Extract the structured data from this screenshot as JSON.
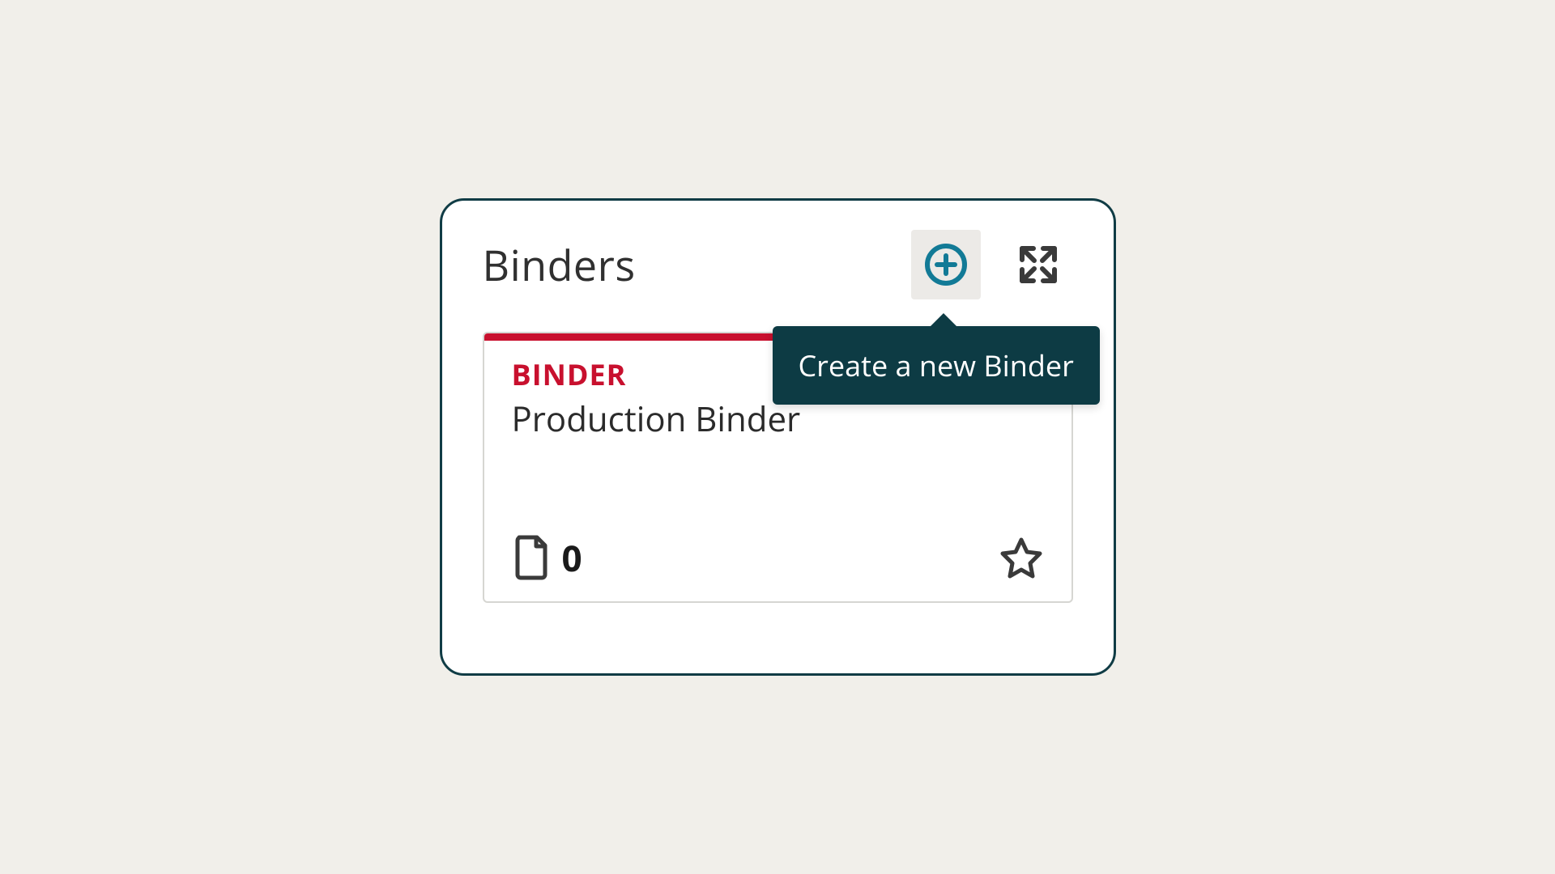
{
  "panel": {
    "title": "Binders",
    "tooltip": "Create a new Binder"
  },
  "binder": {
    "label": "BINDER",
    "name": "Production Binder",
    "doc_count": "0"
  },
  "colors": {
    "accent_red": "#c8102e",
    "accent_teal": "#127a96",
    "tooltip_bg": "#0d3b44"
  }
}
